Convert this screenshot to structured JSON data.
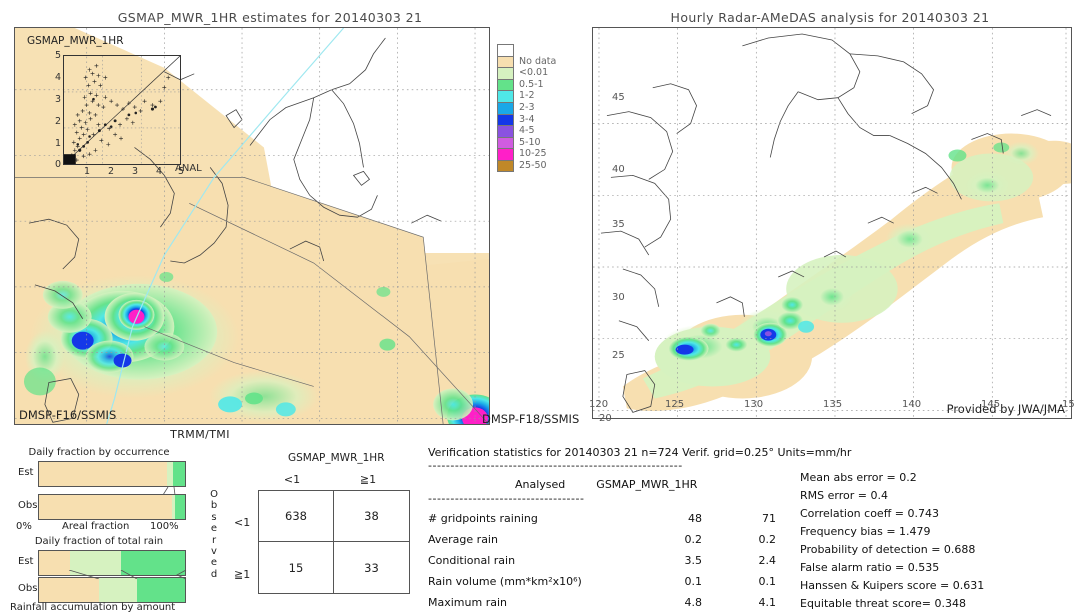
{
  "left_panel": {
    "title": "GSMAP_MWR_1HR estimates for 20140303 21",
    "inset_title": "GSMAP_MWR_1HR",
    "inset_x_label": "ANAL",
    "inset_ticks": [
      "0",
      "1",
      "2",
      "3",
      "4",
      "5"
    ],
    "corner_bottom_left": "DMSP-F16/SSMIS",
    "corner_bottom_right": "DMSP-F18/SSMIS",
    "caption_below": "TRMM/TMI"
  },
  "right_panel": {
    "title": "Hourly Radar-AMeDAS analysis for 20140303 21",
    "credit": "Provided by JWA/JMA",
    "lat_ticks": [
      "45",
      "40",
      "35",
      "30",
      "25",
      "20"
    ],
    "lon_ticks": [
      "120",
      "125",
      "130",
      "135",
      "140",
      "145",
      "15"
    ]
  },
  "colorbar": {
    "entries": [
      {
        "label": "",
        "color": "#ffffff"
      },
      {
        "label": "No data",
        "color": "#f7dfb0"
      },
      {
        "label": "<0.01",
        "color": "#d6f2c0"
      },
      {
        "label": "0.5-1",
        "color": "#63e28a"
      },
      {
        "label": "1-2",
        "color": "#4fe8e8"
      },
      {
        "label": "2-3",
        "color": "#1aa8e8"
      },
      {
        "label": "3-4",
        "color": "#1438e8"
      },
      {
        "label": "4-5",
        "color": "#8a52e0"
      },
      {
        "label": "5-10",
        "color": "#d05ce0"
      },
      {
        "label": "10-25",
        "color": "#ff1fc8"
      },
      {
        "label": "25-50",
        "color": "#c08828"
      }
    ]
  },
  "bar_charts": [
    {
      "title": "Daily fraction by occurrence",
      "axis_label": "Areal fraction",
      "axis_min": "0%",
      "axis_max": "100%",
      "rows": [
        {
          "label": "Est",
          "segments": [
            {
              "color": "#f7dfb0",
              "pct": 88
            },
            {
              "color": "#d6f2c0",
              "pct": 4
            },
            {
              "color": "#63e28a",
              "pct": 8
            }
          ]
        },
        {
          "label": "Obs",
          "segments": [
            {
              "color": "#f7dfb0",
              "pct": 91
            },
            {
              "color": "#d6f2c0",
              "pct": 2
            },
            {
              "color": "#63e28a",
              "pct": 7
            }
          ]
        }
      ]
    },
    {
      "title": "Daily fraction of total rain",
      "caption": "Rainfall accumulation by amount",
      "rows": [
        {
          "label": "Est",
          "segments": [
            {
              "color": "#f7dfb0",
              "pct": 21
            },
            {
              "color": "#d6f2c0",
              "pct": 35
            },
            {
              "color": "#63e28a",
              "pct": 44
            }
          ]
        },
        {
          "label": "Obs",
          "segments": [
            {
              "color": "#f7dfb0",
              "pct": 41
            },
            {
              "color": "#d6f2c0",
              "pct": 26
            },
            {
              "color": "#63e28a",
              "pct": 33
            }
          ]
        }
      ]
    }
  ],
  "contingency": {
    "title": "GSMAP_MWR_1HR",
    "col_headers": [
      "<1",
      "≧1"
    ],
    "row_headers": [
      "<1",
      "≧1"
    ],
    "observed_label": "Observed",
    "cells": [
      "638",
      "38",
      "15",
      "33"
    ]
  },
  "stats": {
    "header": "Verification statistics for 20140303 21   n=724  Verif. grid=0.25°  Units=mm/hr",
    "rule": "---------------------------------------------------------",
    "col_header_left": "Analysed",
    "col_header_right": "GSMAP_MWR_1HR",
    "rule2": "-----------------------------------",
    "rows": [
      {
        "label": "# gridpoints raining",
        "analysed": "48",
        "estimate": "71"
      },
      {
        "label": "Average rain",
        "analysed": "0.2",
        "estimate": "0.2"
      },
      {
        "label": "Conditional rain",
        "analysed": "3.5",
        "estimate": "2.4"
      },
      {
        "label": "Rain volume (mm*km²x10⁶)",
        "analysed": "0.1",
        "estimate": "0.1"
      },
      {
        "label": "Maximum rain",
        "analysed": "4.8",
        "estimate": "4.1"
      }
    ],
    "scores": [
      "Mean abs error = 0.2",
      "RMS error = 0.4",
      "Correlation coeff = 0.743",
      "Frequency bias = 1.479",
      "Probability of detection = 0.688",
      "False alarm ratio = 0.535",
      "Hanssen & Kuipers score = 0.631",
      "Equitable threat score= 0.348"
    ]
  },
  "chart_data": {
    "type": "heatmap",
    "title": "GSMAP_MWR_1HR estimates vs Hourly Radar-AMeDAS analysis for 20140303 21",
    "units": "mm/hr",
    "verification_grid_deg": 0.25,
    "n_samples": 724,
    "colorbar_bins": [
      "No data",
      "<0.01",
      "0.5-1",
      "1-2",
      "2-3",
      "3-4",
      "4-5",
      "5-10",
      "10-25",
      "25-50"
    ],
    "right_map_extent": {
      "lon": [
        120,
        150
      ],
      "lat": [
        20,
        47
      ]
    },
    "scatter_inset": {
      "xlabel": "ANAL",
      "ylabel": "GSMAP_MWR_1HR",
      "xlim": [
        0,
        5
      ],
      "ylim": [
        0,
        5
      ]
    },
    "contingency_matrix": [
      [
        638,
        38
      ],
      [
        15,
        33
      ]
    ],
    "statistics": {
      "mean_abs_error": 0.2,
      "rms_error": 0.4,
      "correlation_coeff": 0.743,
      "frequency_bias": 1.479,
      "probability_of_detection": 0.688,
      "false_alarm_ratio": 0.535,
      "hanssen_kuipers_score": 0.631,
      "equitable_threat_score": 0.348
    },
    "table": {
      "columns": [
        "",
        "Analysed",
        "GSMAP_MWR_1HR"
      ],
      "rows": [
        [
          "# gridpoints raining",
          48,
          71
        ],
        [
          "Average rain",
          0.2,
          0.2
        ],
        [
          "Conditional rain",
          3.5,
          2.4
        ],
        [
          "Rain volume (mm*km^2x10^6)",
          0.1,
          0.1
        ],
        [
          "Maximum rain",
          4.8,
          4.1
        ]
      ]
    }
  }
}
